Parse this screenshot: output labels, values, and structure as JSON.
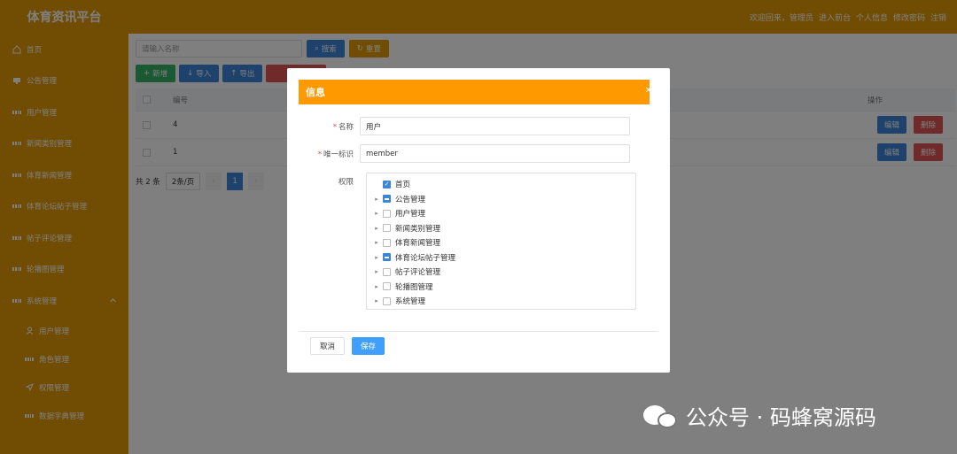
{
  "header": {
    "brand": "体育资讯平台",
    "links": [
      "欢迎回来，管理员",
      "进入前台",
      "个人信息",
      "修改密码",
      "注销"
    ]
  },
  "sidebar": {
    "items": [
      {
        "label": "首页",
        "icon": "home-icon"
      },
      {
        "label": "公告管理",
        "icon": "notice-icon"
      },
      {
        "label": "用户管理",
        "icon": "grid-icon"
      },
      {
        "label": "新闻类别管理",
        "icon": "grid-icon"
      },
      {
        "label": "体育新闻管理",
        "icon": "grid-icon"
      },
      {
        "label": "体育论坛帖子管理",
        "icon": "grid-icon"
      },
      {
        "label": "帖子评论管理",
        "icon": "grid-icon"
      },
      {
        "label": "轮播图管理",
        "icon": "grid-icon"
      }
    ],
    "system": {
      "label": "系统管理",
      "children": [
        {
          "label": "用户管理",
          "icon": "user-icon"
        },
        {
          "label": "角色管理",
          "icon": "grid-icon"
        },
        {
          "label": "权限管理",
          "icon": "send-icon"
        },
        {
          "label": "数据字典管理",
          "icon": "grid-icon"
        }
      ]
    }
  },
  "main": {
    "search_placeholder": "请输入名称",
    "search_btn": "搜索",
    "reset_btn": "重置",
    "add_btn": "新增",
    "import_btn": "导入",
    "export_btn": "导出",
    "table": {
      "col_id": "编号",
      "col_ops": "操作",
      "rows": [
        {
          "id": "4"
        },
        {
          "id": "1"
        }
      ],
      "edit": "编辑",
      "delete": "删除"
    },
    "pager": {
      "total": "共 2 条",
      "size": "2条/页",
      "current": "1"
    }
  },
  "dialog": {
    "title": "信息",
    "name_label": "名称",
    "name_value": "用户",
    "key_label": "唯一标识",
    "key_value": "member",
    "perm_label": "权限",
    "tree": [
      {
        "label": "首页",
        "state": "checked",
        "expandable": false
      },
      {
        "label": "公告管理",
        "state": "partial",
        "expandable": true
      },
      {
        "label": "用户管理",
        "state": "unchecked",
        "expandable": true
      },
      {
        "label": "新闻类别管理",
        "state": "unchecked",
        "expandable": true
      },
      {
        "label": "体育新闻管理",
        "state": "unchecked",
        "expandable": true
      },
      {
        "label": "体育论坛帖子管理",
        "state": "partial",
        "expandable": true
      },
      {
        "label": "帖子评论管理",
        "state": "unchecked",
        "expandable": true
      },
      {
        "label": "轮播图管理",
        "state": "unchecked",
        "expandable": true
      },
      {
        "label": "系统管理",
        "state": "unchecked",
        "expandable": true
      }
    ],
    "cancel": "取消",
    "save": "保存"
  },
  "watermark": "公众号 · 码蜂窝源码",
  "colors": {
    "accent": "#e39a06",
    "dialog_header": "#ff9900",
    "primary": "#409eff",
    "danger": "#e05555"
  }
}
